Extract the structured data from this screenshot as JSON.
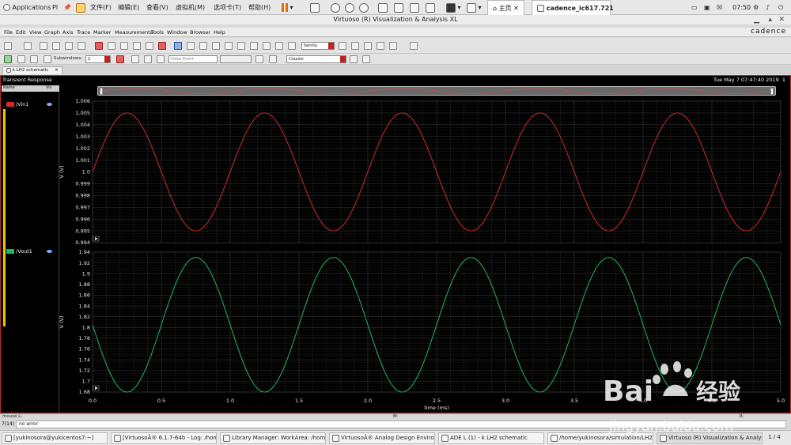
{
  "vm": {
    "applications": "Applications",
    "places": "Pl",
    "menus": [
      "文件(F)",
      "编辑(E)",
      "查看(V)",
      "虚拟机(M)",
      "选项卡(T)",
      "帮助(H)"
    ],
    "tab_home": "主页",
    "tab_vm": "cadence_ic617.721",
    "time": "07:50"
  },
  "window": {
    "title": "Virtuoso (R) Visualization & Analysis XL",
    "menus": [
      "File",
      "Edit",
      "View",
      "Graph",
      "Axis",
      "Trace",
      "Marker",
      "Measurements",
      "Tools",
      "Window",
      "Browser",
      "Help"
    ],
    "logo": "cadence"
  },
  "toolbar": {
    "family": "family",
    "subwindows_label": "Subwindows:",
    "subwindows_value": "1",
    "data_point": "Data Point",
    "style": "Classic"
  },
  "doc_tab": "k LH2 schematic",
  "panel": {
    "title": "Transient Response",
    "date": "Tue May 7 07:47:40 2019",
    "page_no": "1",
    "sidebar_headers": [
      "Name",
      "Vis"
    ]
  },
  "chart_data": [
    {
      "type": "line",
      "series": [
        {
          "name": "/Vin1",
          "color": "#d02a2a",
          "function": "1.0 + 0.005*sin(2*pi*t/1.0)",
          "amplitude": 0.005,
          "offset": 1.0,
          "period_ms": 1.0
        }
      ],
      "ylabel": "V (V)",
      "ylim": [
        0.994,
        1.006
      ],
      "yticks": [
        "1.006",
        "1.005",
        "1.004",
        "1.003",
        "1.002",
        "1.001",
        "1.0",
        "0.999",
        "0.998",
        "0.997",
        "0.996",
        "0.995",
        "0.994"
      ],
      "xlim": [
        0.0,
        5.0
      ],
      "grid": true
    },
    {
      "type": "line",
      "series": [
        {
          "name": "/Vout1",
          "color": "#1fb860",
          "function": "1.805 - 0.125*sin(2*pi*t/1.0)",
          "amplitude": 0.125,
          "offset": 1.805,
          "period_ms": 1.0
        }
      ],
      "ylabel": "V (V)",
      "ylim": [
        1.68,
        1.94
      ],
      "yticks": [
        "1.94",
        "1.92",
        "1.9",
        "1.88",
        "1.86",
        "1.84",
        "1.82",
        "1.8",
        "1.78",
        "1.76",
        "1.74",
        "1.72",
        "1.7",
        "1.68"
      ],
      "xlim": [
        0.0,
        5.0
      ],
      "xticks": [
        "0.0",
        "0.5",
        "1.0",
        "1.5",
        "2.0",
        "2.5",
        "3.0",
        "3.5",
        "4.0",
        "4.5",
        "5.0"
      ],
      "xlabel": "time (ms)",
      "grid": true
    }
  ],
  "status": {
    "mouse": "mouse L:",
    "mid": "M:",
    "right": "R:",
    "line_no": "7(14)",
    "message": "no error"
  },
  "taskbar": {
    "items": [
      "[yukinosora@yukicentos7:~]",
      "[VirtuosoÂ® 6.1.7-64b - Log: /hom...",
      "Library Manager: WorkArea: /home/...",
      "VirtuosoÂ® Analog Design Environm...",
      "ADE L (1) - k LH2 schematic",
      "/home/yukinosora/simulation/LH2/s...",
      "Virtuoso (R) Visualization & Analysis..."
    ],
    "page": "1 / 4"
  },
  "watermark": {
    "brand": "Bai",
    "brand2": "经验",
    "url": "jingyan.baidu.com"
  }
}
